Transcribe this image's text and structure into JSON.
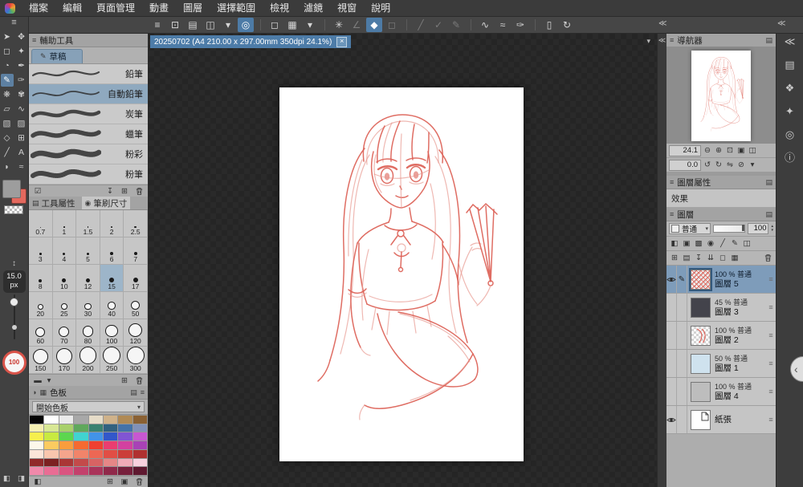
{
  "colors": {
    "accent_blue": "#4d7ba6",
    "selection_blue": "#7e9cba",
    "sketch_red": "#dc6156",
    "main_color": "#9d9d9d",
    "sub_color": "#e4695e"
  },
  "icons": {
    "panel_handle": "≡",
    "chevron_down": "▾",
    "panel_menu": "▤",
    "edit_pencil": "✎",
    "size_arrows": "↕",
    "collapse_left": "≪",
    "collapse_handle": "‹",
    "spin_up": "▴",
    "spin_down": "▾"
  },
  "menu_bar": {
    "items": [
      {
        "name": "menu-file",
        "label": "檔案"
      },
      {
        "name": "menu-edit",
        "label": "編輯"
      },
      {
        "name": "menu-page-manage",
        "label": "頁面管理"
      },
      {
        "name": "menu-animation",
        "label": "動畫"
      },
      {
        "name": "menu-layer",
        "label": "圖層"
      },
      {
        "name": "menu-selection",
        "label": "選擇範圍"
      },
      {
        "name": "menu-view",
        "label": "檢視"
      },
      {
        "name": "menu-filter",
        "label": "濾鏡"
      },
      {
        "name": "menu-window",
        "label": "視窗"
      },
      {
        "name": "menu-help",
        "label": "說明"
      }
    ]
  },
  "toolbar": {
    "buttons": [
      {
        "name": "toolbar-menu-icon",
        "glyph": "≡"
      },
      {
        "name": "window-fit-icon",
        "glyph": "⊡"
      },
      {
        "name": "save-icon",
        "glyph": "▤"
      },
      {
        "name": "export-icon",
        "glyph": "◫"
      },
      {
        "name": "export-dropdown-icon",
        "glyph": "▾"
      },
      {
        "name": "color-mix-icon",
        "glyph": "◎",
        "state": "active"
      },
      {
        "sep": true
      },
      {
        "name": "selection-launcher-icon",
        "glyph": "◻"
      },
      {
        "name": "selection-convert-icon",
        "glyph": "▦"
      },
      {
        "name": "selection-dropdown-icon",
        "glyph": "▾"
      },
      {
        "sep": true
      },
      {
        "name": "refresh-process-icon",
        "glyph": "✳"
      },
      {
        "name": "snap-angle-icon",
        "glyph": "∠",
        "state": "disabled"
      },
      {
        "name": "fill-polygon-icon",
        "glyph": "◆",
        "state": "active"
      },
      {
        "name": "frame-select-icon",
        "glyph": "◻",
        "state": "disabled"
      },
      {
        "sep": true
      },
      {
        "name": "snap-line-icon",
        "glyph": "╱",
        "state": "disabled"
      },
      {
        "name": "snap-check-icon",
        "glyph": "✓",
        "state": "disabled"
      },
      {
        "name": "draw-correction-icon",
        "glyph": "✎",
        "state": "disabled"
      },
      {
        "sep": true
      },
      {
        "name": "stroke-wave-icon",
        "glyph": "∿"
      },
      {
        "name": "stroke-smooth-icon",
        "glyph": "≈"
      },
      {
        "name": "vector-pen-icon",
        "glyph": "✑"
      },
      {
        "sep": true
      },
      {
        "name": "companion-device-icon",
        "glyph": "▯"
      },
      {
        "name": "sync-refresh-icon",
        "glyph": "↻"
      }
    ]
  },
  "tool_strip": {
    "tools": [
      {
        "name": "operation-tool",
        "glyph": "➤"
      },
      {
        "name": "move-layer-tool",
        "glyph": "✥"
      },
      {
        "name": "selection-tool",
        "glyph": "◻"
      },
      {
        "name": "auto-select-tool",
        "glyph": "✦"
      },
      {
        "name": "eyedropper-tool",
        "glyph": "◔"
      },
      {
        "name": "pen-tool",
        "glyph": "✒"
      },
      {
        "name": "pencil-tool",
        "glyph": "✎",
        "selected": true
      },
      {
        "name": "brush-tool",
        "glyph": "✑"
      },
      {
        "name": "airbrush-tool",
        "glyph": "❋"
      },
      {
        "name": "decoration-tool",
        "glyph": "✾"
      },
      {
        "name": "eraser-tool",
        "glyph": "▱"
      },
      {
        "name": "blend-tool",
        "glyph": "∿"
      },
      {
        "name": "fill-tool",
        "glyph": "▧"
      },
      {
        "name": "gradient-tool",
        "glyph": "▨"
      },
      {
        "name": "figure-tool",
        "glyph": "◇"
      },
      {
        "name": "frame-border-tool",
        "glyph": "⊞"
      },
      {
        "name": "ruler-tool",
        "glyph": "╱"
      },
      {
        "name": "text-tool",
        "glyph": "A"
      },
      {
        "name": "balloon-tool",
        "glyph": "◗"
      },
      {
        "name": "line-correct-tool",
        "glyph": "≈"
      }
    ],
    "brush_size": {
      "value": "15.0",
      "unit": "px"
    },
    "opacity": {
      "value": "100"
    },
    "footer_icons": [
      {
        "name": "toggle-left-panel-icon",
        "glyph": "◧"
      },
      {
        "name": "toggle-right-panel-icon",
        "glyph": "◨"
      }
    ]
  },
  "subtool_panel": {
    "title": "輔助工具",
    "group_tab": "草稿",
    "brushes": [
      {
        "name": "subtool-pencil",
        "label": "鉛筆"
      },
      {
        "name": "subtool-mechanical-pencil",
        "label": "自動鉛筆",
        "selected": true
      },
      {
        "name": "subtool-charcoal",
        "label": "炭筆"
      },
      {
        "name": "subtool-crayon",
        "label": "蠟筆"
      },
      {
        "name": "subtool-pastel",
        "label": "粉彩"
      },
      {
        "name": "subtool-chalk",
        "label": "粉筆"
      }
    ],
    "footer_left": [
      {
        "name": "show-all-checkbox-icon",
        "glyph": "☑"
      }
    ],
    "footer_right": [
      {
        "name": "import-subtool-icon",
        "glyph": "↧"
      },
      {
        "name": "duplicate-subtool-icon",
        "glyph": "⊞"
      },
      {
        "name": "delete-subtool-icon",
        "glyph": "TRASH"
      }
    ]
  },
  "tool_property_panel": {
    "tab_property": "工具屬性",
    "tab_property_icon": "▤",
    "tab_brush_size": "筆刷尺寸",
    "tab_brush_size_icon": "◉",
    "selected_size": "15",
    "sizes": [
      "0.7",
      "1",
      "1.5",
      "2",
      "2.5",
      "3",
      "4",
      "5",
      "6",
      "7",
      "8",
      "10",
      "12",
      "15",
      "17",
      "20",
      "25",
      "30",
      "40",
      "50",
      "60",
      "70",
      "80",
      "100",
      "120",
      "150",
      "170",
      "200",
      "250",
      "300"
    ],
    "footer_left": [
      {
        "name": "stroke-bar-icon",
        "glyph": "▬"
      },
      {
        "name": "stroke-bar-dropdown-icon",
        "glyph": "▾"
      }
    ],
    "footer_right": [
      {
        "name": "add-size-icon",
        "glyph": "⊞"
      },
      {
        "name": "delete-size-icon",
        "glyph": "TRASH"
      }
    ]
  },
  "color_palette": {
    "title": "色板",
    "set_selector": "開始色板",
    "header_tabs": [
      {
        "name": "color-wheel-tab-icon",
        "glyph": "◑"
      },
      {
        "name": "swatch-set-tab-icon",
        "glyph": "▦"
      }
    ],
    "header_right": [
      {
        "name": "palette-options-icon",
        "glyph": "▤"
      },
      {
        "name": "palette-menu-icon",
        "glyph": "≡"
      }
    ],
    "rows": [
      [
        "#050505",
        "#ffffff",
        "#ebebeb",
        "#a8a8a8",
        "#e6dcc8",
        "#cfb28a",
        "#b08a55",
        "#8a6134"
      ],
      [
        "#f4efb2",
        "#d8e795",
        "#a8d06b",
        "#5fa85c",
        "#3a8271",
        "#31617f",
        "#4472a8",
        "#8191b8"
      ],
      [
        "#f6ef4d",
        "#c8ea41",
        "#5cd64f",
        "#41d3d0",
        "#4293e9",
        "#3257ca",
        "#8155d3",
        "#c757d1"
      ],
      [
        "#fdf8ea",
        "#fbcb60",
        "#f99d3d",
        "#f56a31",
        "#ef4031",
        "#ea3d70",
        "#d341a0",
        "#a842b6"
      ],
      [
        "#fce5d9",
        "#f9c6ae",
        "#f5a58c",
        "#f1846a",
        "#ed6754",
        "#e14e45",
        "#cb3e39",
        "#b03130"
      ],
      [
        "#912929",
        "#7c2121",
        "#aa3636",
        "#c34a4a",
        "#d86363",
        "#e68686",
        "#f1abb7",
        "#f8d2de"
      ],
      [
        "#f089aa",
        "#e96d94",
        "#da5480",
        "#c3416c",
        "#aa345a",
        "#90294a",
        "#77203c",
        "#5f1930"
      ]
    ],
    "footer_left": [
      {
        "name": "swap-colors-icon",
        "glyph": "◧"
      }
    ],
    "footer_right": [
      {
        "name": "add-color-icon",
        "glyph": "⊞"
      },
      {
        "name": "replace-color-icon",
        "glyph": "▣"
      },
      {
        "name": "delete-color-icon",
        "glyph": "TRASH"
      }
    ]
  },
  "canvas": {
    "tab_title": "20250702 (A4 210.00 x 297.00mm 350dpi 24.1%)",
    "close_glyph": "×"
  },
  "navigator": {
    "title": "導航器",
    "zoom_value": "24.1",
    "rotation_value": "0.0",
    "zoom_icons": [
      {
        "name": "zoom-out-icon",
        "glyph": "⊖"
      },
      {
        "name": "zoom-in-icon",
        "glyph": "⊕"
      },
      {
        "name": "fit-to-screen-icon",
        "glyph": "⊡"
      },
      {
        "name": "actual-pixels-icon",
        "glyph": "▣"
      },
      {
        "name": "zoom-options-icon",
        "glyph": "◫"
      }
    ],
    "rotate_icons": [
      {
        "name": "rotate-left-icon",
        "glyph": "↺"
      },
      {
        "name": "rotate-right-icon",
        "glyph": "↻"
      },
      {
        "name": "flip-horizontal-icon",
        "glyph": "⇋"
      },
      {
        "name": "reset-rotation-icon",
        "glyph": "⊘"
      },
      {
        "name": "rotate-options-icon",
        "glyph": "▾"
      }
    ]
  },
  "layer_property_panel": {
    "title": "圖層屬性",
    "effect_label": "效果"
  },
  "layer_panel": {
    "title": "圖層",
    "blend_mode": "普通",
    "opacity_value": "100",
    "tool_icons_row1": [
      {
        "name": "clip-to-below-icon",
        "glyph": "◧"
      },
      {
        "name": "lock-layer-icon",
        "glyph": "▣"
      },
      {
        "name": "lock-alpha-icon",
        "glyph": "▩"
      },
      {
        "name": "enable-mask-icon",
        "glyph": "◉"
      },
      {
        "name": "ruler-snap-icon",
        "glyph": "╱"
      },
      {
        "name": "set-draft-icon",
        "glyph": "✎"
      },
      {
        "name": "layer-color-icon",
        "glyph": "◫"
      }
    ],
    "tool_icons_row2": [
      {
        "name": "new-raster-layer-icon",
        "glyph": "⊞"
      },
      {
        "name": "new-folder-icon",
        "glyph": "▤"
      },
      {
        "name": "transfer-to-below-icon",
        "glyph": "↧"
      },
      {
        "name": "merge-to-below-icon",
        "glyph": "⇊"
      },
      {
        "name": "create-mask-icon",
        "glyph": "◻"
      },
      {
        "name": "apply-mask-icon",
        "glyph": "▦"
      },
      {
        "name": "delete-layer-icon",
        "glyph": "TRASH"
      }
    ],
    "layers": [
      {
        "info": "100 % 普通",
        "name": "圖層 5",
        "thumb": "hatch",
        "selected": true,
        "visible": true,
        "editing": true
      },
      {
        "info": "45 % 普通",
        "name": "圖層 3",
        "thumb": "dark",
        "visible": false
      },
      {
        "info": "100 % 普通",
        "name": "圖層 2",
        "thumb": "sketch",
        "visible": false
      },
      {
        "info": "50 % 普通",
        "name": "圖層 1",
        "thumb": "blue",
        "visible": false
      },
      {
        "info": "100 % 普通",
        "name": "圖層 4",
        "thumb": "gray",
        "visible": false
      },
      {
        "info": "",
        "name": "紙張",
        "thumb": "paper",
        "visible": true
      }
    ]
  },
  "right_strip": {
    "tabs": [
      {
        "name": "collapse-panels-icon",
        "glyph": "≪"
      },
      {
        "name": "navigator-tab-icon",
        "glyph": "▤"
      },
      {
        "name": "material-tab-icon",
        "glyph": "❖"
      },
      {
        "name": "material-tab-2-icon",
        "glyph": "✦"
      },
      {
        "name": "subview-tab-icon",
        "glyph": "◎"
      },
      {
        "name": "information-tab-icon",
        "glyph": "ⓘ"
      }
    ]
  }
}
